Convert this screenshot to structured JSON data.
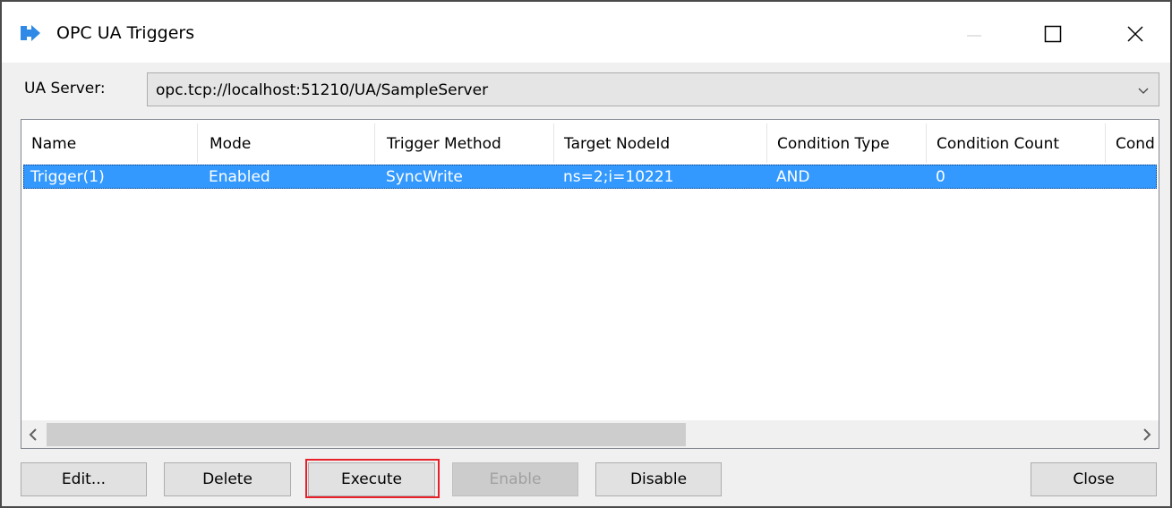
{
  "window": {
    "title": "OPC UA Triggers",
    "icon": "arrow-right-icon",
    "accent": "#3399ff"
  },
  "server": {
    "label": "UA Server:",
    "value": "opc.tcp://localhost:51210/UA/SampleServer"
  },
  "list": {
    "columns": [
      "Name",
      "Mode",
      "Trigger Method",
      "Target NodeId",
      "Condition Type",
      "Condition Count",
      "Cond"
    ],
    "rows": [
      {
        "name": "Trigger(1)",
        "mode": "Enabled",
        "method": "SyncWrite",
        "target": "ns=2;i=10221",
        "ctype": "AND",
        "ccount": "0",
        "selected": true
      }
    ]
  },
  "buttons": {
    "edit": "Edit...",
    "delete": "Delete",
    "execute": "Execute",
    "enable": "Enable",
    "disable": "Disable",
    "close": "Close"
  },
  "highlight_color": "#e8202a"
}
